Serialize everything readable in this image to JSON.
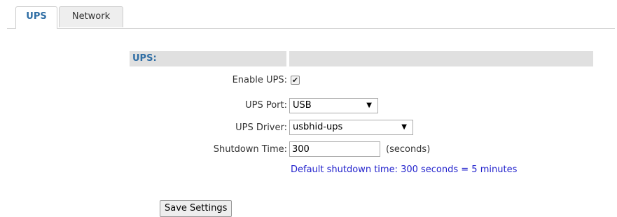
{
  "tabs": [
    {
      "label": "UPS",
      "active": true
    },
    {
      "label": "Network",
      "active": false
    }
  ],
  "section": {
    "title": "UPS:"
  },
  "fields": {
    "enable_ups": {
      "label": "Enable UPS:",
      "checked": true
    },
    "ups_port": {
      "label": "UPS Port:",
      "value": "USB"
    },
    "ups_driver": {
      "label": "UPS Driver:",
      "value": "usbhid-ups"
    },
    "shutdown_time": {
      "label": "Shutdown Time:",
      "value": "300",
      "unit": "(seconds)"
    }
  },
  "hint": "Default shutdown time: 300 seconds = 5 minutes",
  "save_label": "Save Settings",
  "icons": {
    "dropdown_arrow": "▼",
    "checkmark": "✔"
  },
  "colors": {
    "accent": "#2e6da4",
    "hint": "#2222cc",
    "header_bg": "#e0e0e0"
  }
}
